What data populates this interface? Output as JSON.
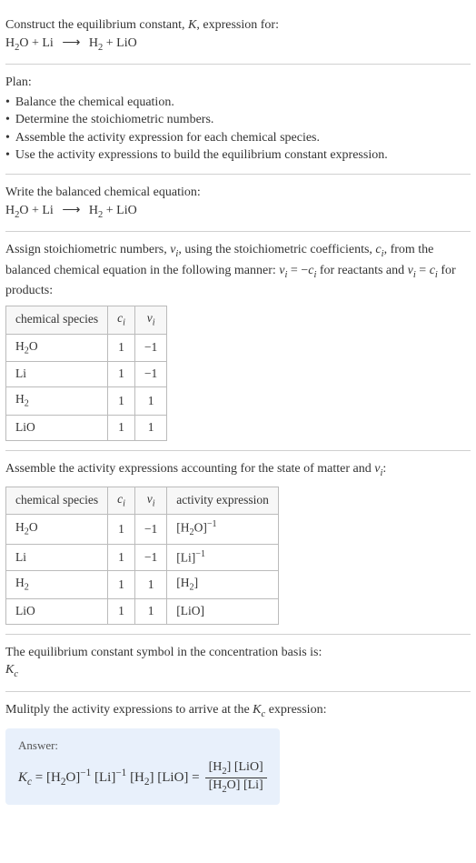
{
  "prompt": {
    "line1": "Construct the equilibrium constant, ",
    "k": "K",
    "line1b": ", expression for:",
    "equation_lhs_a": "H",
    "equation_lhs_a_sub": "2",
    "equation_lhs_b": "O + Li",
    "arrow": "⟶",
    "equation_rhs_a": "H",
    "equation_rhs_a_sub": "2",
    "equation_rhs_b": " + LiO"
  },
  "plan": {
    "heading": "Plan:",
    "items": [
      "Balance the chemical equation.",
      "Determine the stoichiometric numbers.",
      "Assemble the activity expression for each chemical species.",
      "Use the activity expressions to build the equilibrium constant expression."
    ]
  },
  "balanced": {
    "heading": "Write the balanced chemical equation:"
  },
  "stoich": {
    "line_a": "Assign stoichiometric numbers, ",
    "nu": "ν",
    "isub": "i",
    "line_b": ", using the stoichiometric coefficients, ",
    "c": "c",
    "line_c": ", from the balanced chemical equation in the following manner: ",
    "eq1_a": "ν",
    "eq1_b": " = −",
    "eq1_c": "c",
    "line_d": " for reactants and ",
    "eq2_a": "ν",
    "eq2_b": " = ",
    "eq2_c": "c",
    "line_e": " for products:",
    "headers": {
      "species": "chemical species",
      "ci": "c",
      "nui": "ν"
    },
    "rows": [
      {
        "species_a": "H",
        "species_sub": "2",
        "species_b": "O",
        "ci": "1",
        "nui": "−1"
      },
      {
        "species_a": "Li",
        "species_sub": "",
        "species_b": "",
        "ci": "1",
        "nui": "−1"
      },
      {
        "species_a": "H",
        "species_sub": "2",
        "species_b": "",
        "ci": "1",
        "nui": "1"
      },
      {
        "species_a": "LiO",
        "species_sub": "",
        "species_b": "",
        "ci": "1",
        "nui": "1"
      }
    ]
  },
  "activity": {
    "heading_a": "Assemble the activity expressions accounting for the state of matter and ",
    "heading_b": ":",
    "headers": {
      "species": "chemical species",
      "ci": "c",
      "nui": "ν",
      "expr": "activity expression"
    },
    "rows": [
      {
        "sp_a": "H",
        "sp_sub": "2",
        "sp_b": "O",
        "ci": "1",
        "nui": "−1",
        "ex_a": "[H",
        "ex_sub": "2",
        "ex_b": "O]",
        "ex_sup": "−1"
      },
      {
        "sp_a": "Li",
        "sp_sub": "",
        "sp_b": "",
        "ci": "1",
        "nui": "−1",
        "ex_a": "[Li]",
        "ex_sub": "",
        "ex_b": "",
        "ex_sup": "−1"
      },
      {
        "sp_a": "H",
        "sp_sub": "2",
        "sp_b": "",
        "ci": "1",
        "nui": "1",
        "ex_a": "[H",
        "ex_sub": "2",
        "ex_b": "]",
        "ex_sup": ""
      },
      {
        "sp_a": "LiO",
        "sp_sub": "",
        "sp_b": "",
        "ci": "1",
        "nui": "1",
        "ex_a": "[LiO]",
        "ex_sub": "",
        "ex_b": "",
        "ex_sup": ""
      }
    ]
  },
  "kc_symbol": {
    "line": "The equilibrium constant symbol in the concentration basis is:",
    "k": "K",
    "c": "c"
  },
  "multiply": {
    "line_a": "Mulitply the activity expressions to arrive at the ",
    "k": "K",
    "c": "c",
    "line_b": " expression:"
  },
  "answer": {
    "label": "Answer:",
    "k": "K",
    "c": "c",
    "eq": " = ",
    "t1_a": "[H",
    "t1_sub": "2",
    "t1_b": "O]",
    "t1_sup": "−1",
    "t2_a": "[Li]",
    "t2_sup": "−1",
    "t3_a": "[H",
    "t3_sub": "2",
    "t3_b": "]",
    "t4": "[LiO]",
    "eq2": " = ",
    "num_a": "[H",
    "num_sub": "2",
    "num_b": "] [LiO]",
    "den_a": "[H",
    "den_sub": "2",
    "den_b": "O] [Li]"
  }
}
